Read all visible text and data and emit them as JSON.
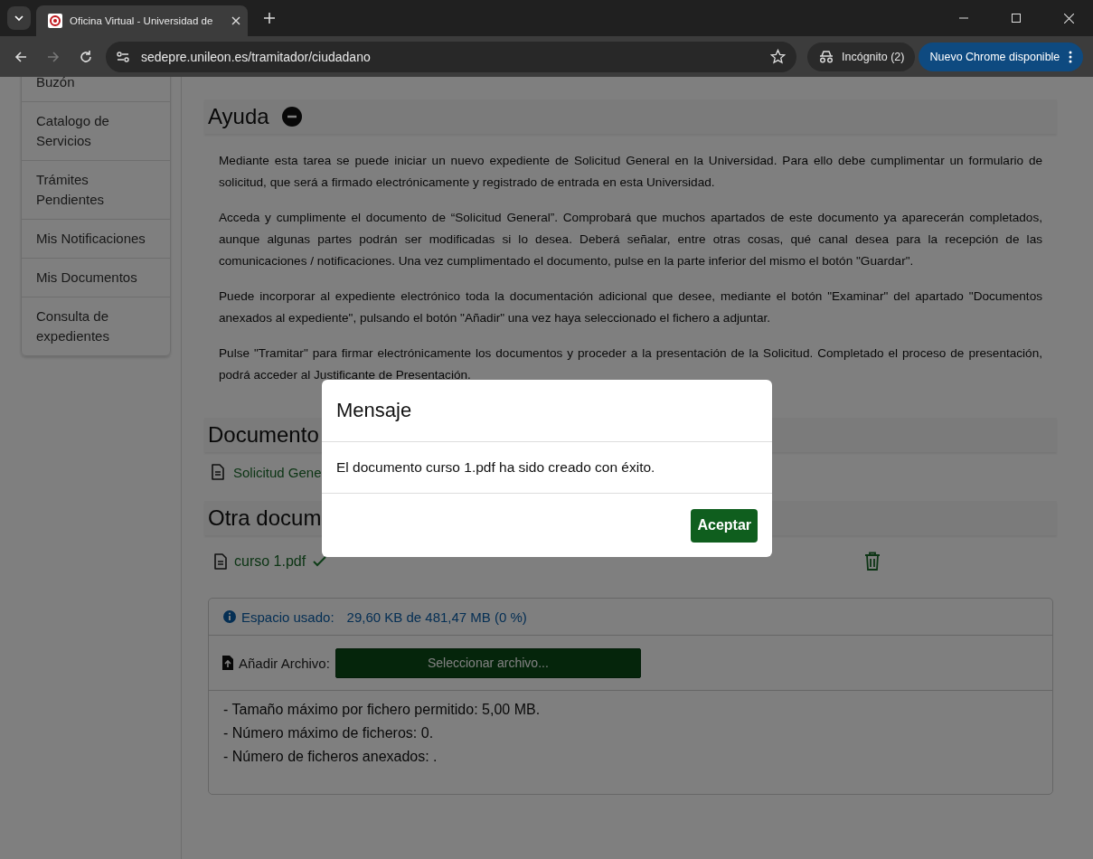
{
  "browser": {
    "tabs": [
      {
        "title": "Oficina Virtual - Universidad de",
        "selected": true
      }
    ],
    "address": "sedepre.unileon.es/tramitador/ciudadano",
    "incognito": "Incógnito (2)",
    "update_button": "Nuevo Chrome disponible"
  },
  "sidebar": {
    "items": [
      {
        "label": "Buzón"
      },
      {
        "label": "Catalogo de Servicios"
      },
      {
        "label": "Trámites Pendientes"
      },
      {
        "label": "Mis Notificaciones"
      },
      {
        "label": "Mis Documentos"
      },
      {
        "label": "Consulta de expedientes"
      }
    ]
  },
  "help": {
    "title": "Ayuda",
    "expanded": true,
    "paragraphs": [
      "Mediante esta tarea se puede iniciar un nuevo expediente de Solicitud General en la Universidad. Para ello debe cumplimentar un formulario de solicitud, que será a firmado electrónicamente y registrado de entrada en esta Universidad.",
      "Acceda y cumplimente el documento de “Solicitud General”. Comprobará que muchos apartados de este documento ya aparecerán completados, aunque algunas partes podrán ser modificadas si lo desea. Deberá señalar, entre otras cosas, qué canal desea para la recepción de las comunicaciones / notificaciones. Una vez cumplimentado el documento, pulse en la parte inferior del mismo el botón \"Guardar\".",
      "Puede incorporar al expediente electrónico toda la documentación adicional que desee, mediante el botón \"Examinar\" del apartado \"Documentos anexados al expediente\", pulsando el botón \"Añadir\" una vez haya seleccionado el fichero a adjuntar.",
      "Pulse \"Tramitar\" para firmar electrónicamente los documentos y proceder a la presentación de la Solicitud. Completado el proceso de presentación, podrá acceder al Justificante de Presentación."
    ]
  },
  "documents": {
    "title": "Documento",
    "items": [
      {
        "name": "Solicitud Gene"
      }
    ]
  },
  "other_documents": {
    "title": "Otra docum",
    "files": [
      {
        "name": "curso 1.pdf",
        "uploaded": true
      }
    ]
  },
  "storage": {
    "label": "Espacio usado:",
    "value": "29,60 KB de 481,47 MB (0 %)",
    "add_label": "Añadir Archivo:",
    "select_button": "Seleccionar archivo...",
    "notes": [
      "- Tamaño máximo por fichero permitido:  5,00 MB.",
      "- Número máximo de ficheros: 0.",
      "- Número de ficheros anexados: ."
    ]
  },
  "dialog": {
    "title": "Mensaje",
    "message": "El documento curso 1.pdf ha sido creado con éxito.",
    "button": "Aceptar"
  }
}
